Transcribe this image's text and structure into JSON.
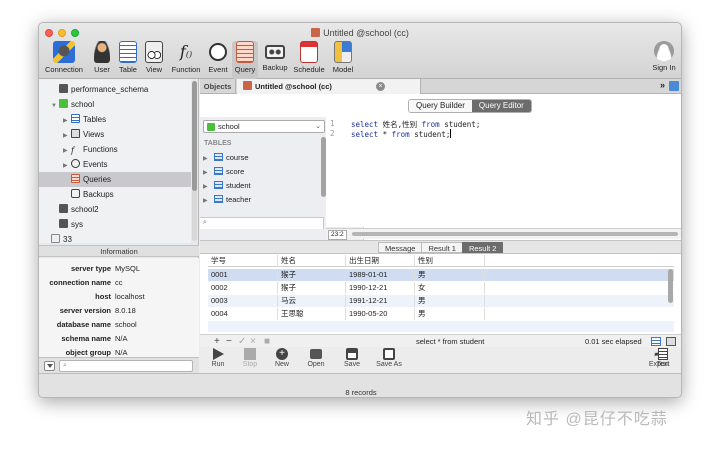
{
  "window": {
    "title": "Untitled @school (cc)"
  },
  "toolbar": {
    "items": [
      {
        "label": "Connection",
        "icon": "connection-icon"
      },
      {
        "label": "User",
        "icon": "user-icon"
      },
      {
        "label": "Table",
        "icon": "table-icon"
      },
      {
        "label": "View",
        "icon": "view-icon"
      },
      {
        "label": "Function",
        "icon": "function-icon"
      },
      {
        "label": "Event",
        "icon": "event-icon"
      },
      {
        "label": "Query",
        "icon": "query-icon"
      },
      {
        "label": "Backup",
        "icon": "backup-icon"
      },
      {
        "label": "Schedule",
        "icon": "schedule-icon"
      },
      {
        "label": "Model",
        "icon": "model-icon"
      }
    ],
    "signin": "Sign In"
  },
  "tree": {
    "items": [
      {
        "label": "performance_schema"
      },
      {
        "label": "school"
      },
      {
        "label": "Tables"
      },
      {
        "label": "Views"
      },
      {
        "label": "Functions"
      },
      {
        "label": "Events"
      },
      {
        "label": "Queries"
      },
      {
        "label": "Backups"
      },
      {
        "label": "school2"
      },
      {
        "label": "sys"
      },
      {
        "label": "33"
      }
    ]
  },
  "info": {
    "header": "Information",
    "rows": [
      {
        "key": "server type",
        "value": "MySQL"
      },
      {
        "key": "connection name",
        "value": "cc"
      },
      {
        "key": "host",
        "value": "localhost"
      },
      {
        "key": "server version",
        "value": "8.0.18"
      },
      {
        "key": "database name",
        "value": "school"
      },
      {
        "key": "schema name",
        "value": "N/A"
      },
      {
        "key": "object group",
        "value": "N/A"
      }
    ]
  },
  "tabs": {
    "objects": "Objects",
    "query": "Untitled @school (cc)"
  },
  "mode": {
    "builder": "Query Builder",
    "editor": "Query Editor"
  },
  "db_pane": {
    "selected": "school",
    "tables_header": "TABLES",
    "tables": [
      "course",
      "score",
      "student",
      "teacher"
    ]
  },
  "editor": {
    "lines": [
      {
        "num": "1",
        "kw1": "select",
        "mid": " 姓名,性别 ",
        "kw2": "from",
        "tail": " student;"
      },
      {
        "num": "2",
        "kw1": "select",
        "mid": " * ",
        "kw2": "from",
        "tail": " student;"
      }
    ],
    "position": "23:2"
  },
  "result_tabs": [
    "Message",
    "Result 1",
    "Result 2"
  ],
  "grid": {
    "columns": [
      "学号",
      "姓名",
      "出生日期",
      "性别"
    ],
    "rows": [
      [
        "0001",
        "猴子",
        "1989-01-01",
        "男"
      ],
      [
        "0002",
        "猴子",
        "1990-12-21",
        "女"
      ],
      [
        "0003",
        "马云",
        "1991-12-21",
        "男"
      ],
      [
        "0004",
        "王思聪",
        "1990-05-20",
        "男"
      ]
    ]
  },
  "grid_bar": {
    "sql": "select * from student",
    "elapsed": "0.01 sec elapsed"
  },
  "actions": {
    "run": "Run",
    "stop": "Stop",
    "new": "New",
    "open": "Open",
    "save": "Save",
    "save_as": "Save As",
    "export": "Export",
    "text": "Text"
  },
  "status": "8 records",
  "watermark": "知乎 @昆仔不吃蒜"
}
